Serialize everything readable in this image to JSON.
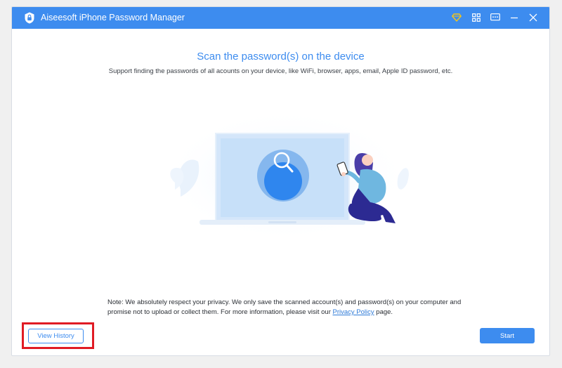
{
  "window": {
    "title": "Aiseesoft iPhone Password Manager",
    "controls": {
      "premium_icon": "diamond-icon",
      "menu_icon": "grid-icon",
      "feedback_icon": "chat-icon",
      "minimize_icon": "minimize-icon",
      "close_icon": "close-icon"
    }
  },
  "main": {
    "title": "Scan the password(s) on the device",
    "subtitle": "Support finding the passwords of all acounts on your device, like  WiFi, browser, apps, email, Apple ID password, etc."
  },
  "note": {
    "text_before": "Note: We absolutely respect your privacy. We only save the scanned account(s) and password(s) on your computer and promise not to upload or collect them. For more information, please visit our ",
    "link": "Privacy Policy",
    "text_after": " page."
  },
  "buttons": {
    "view_history": "View History",
    "start": "Start"
  },
  "colors": {
    "accent": "#3d8cef",
    "highlight": "#e01b24",
    "premium": "#f5c518"
  }
}
